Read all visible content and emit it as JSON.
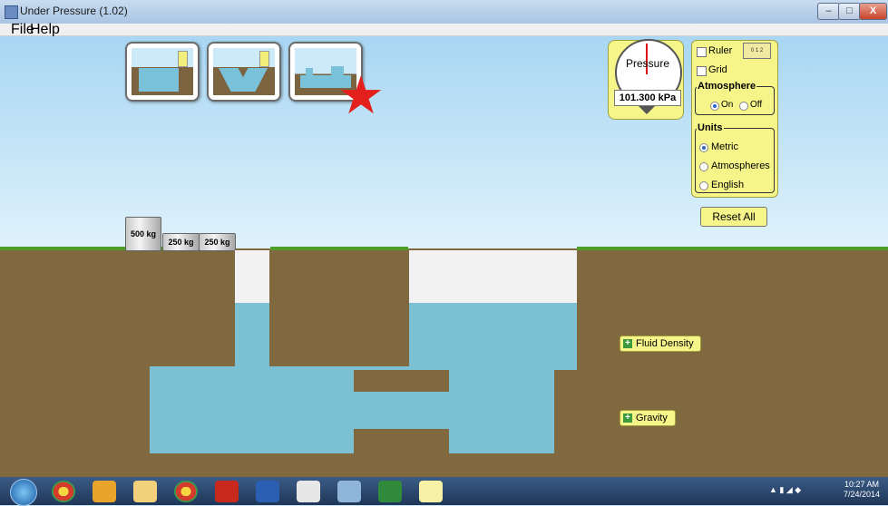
{
  "window": {
    "title": "Under Pressure (1.02)",
    "min": "–",
    "max": "□",
    "close": "X"
  },
  "menu": {
    "file": "File",
    "help": "Help"
  },
  "gauge": {
    "label": "Pressure",
    "readout": "101.300 kPa"
  },
  "panel": {
    "ruler": "Ruler",
    "grid": "Grid",
    "ruler_icon_ticks": "0 1 2",
    "atmosphere_title": "Atmosphere",
    "atmosphere_on": "On",
    "atmosphere_off": "Off",
    "atmosphere_selected": "On",
    "units_title": "Units",
    "units_metric": "Metric",
    "units_atmospheres": "Atmospheres",
    "units_english": "English",
    "units_selected": "Metric"
  },
  "reset_label": "Reset All",
  "weights": {
    "large": "500 kg",
    "medium1": "250 kg",
    "medium2": "250 kg"
  },
  "controls": {
    "fluid_density": "Fluid Density",
    "gravity": "Gravity"
  },
  "taskbar": {
    "time": "10:27 AM",
    "date": "7/24/2014"
  },
  "colors": {
    "water": "#7cc1d3",
    "ground": "#80683f",
    "panel": "#f6f58a",
    "star": "#e3201b",
    "grass": "#4f9d2b"
  },
  "icons": [
    "java-icon",
    "minimize-icon",
    "maximize-icon",
    "close-icon",
    "pressure-gauge-icon",
    "ruler-icon",
    "plus-icon",
    "star-icon",
    "windows-start-icon",
    "chrome-icon",
    "outlook-icon",
    "explorer-icon",
    "pdf-icon",
    "word-icon",
    "java-app-icon",
    "paint-icon",
    "excel-icon",
    "notepad-icon"
  ]
}
